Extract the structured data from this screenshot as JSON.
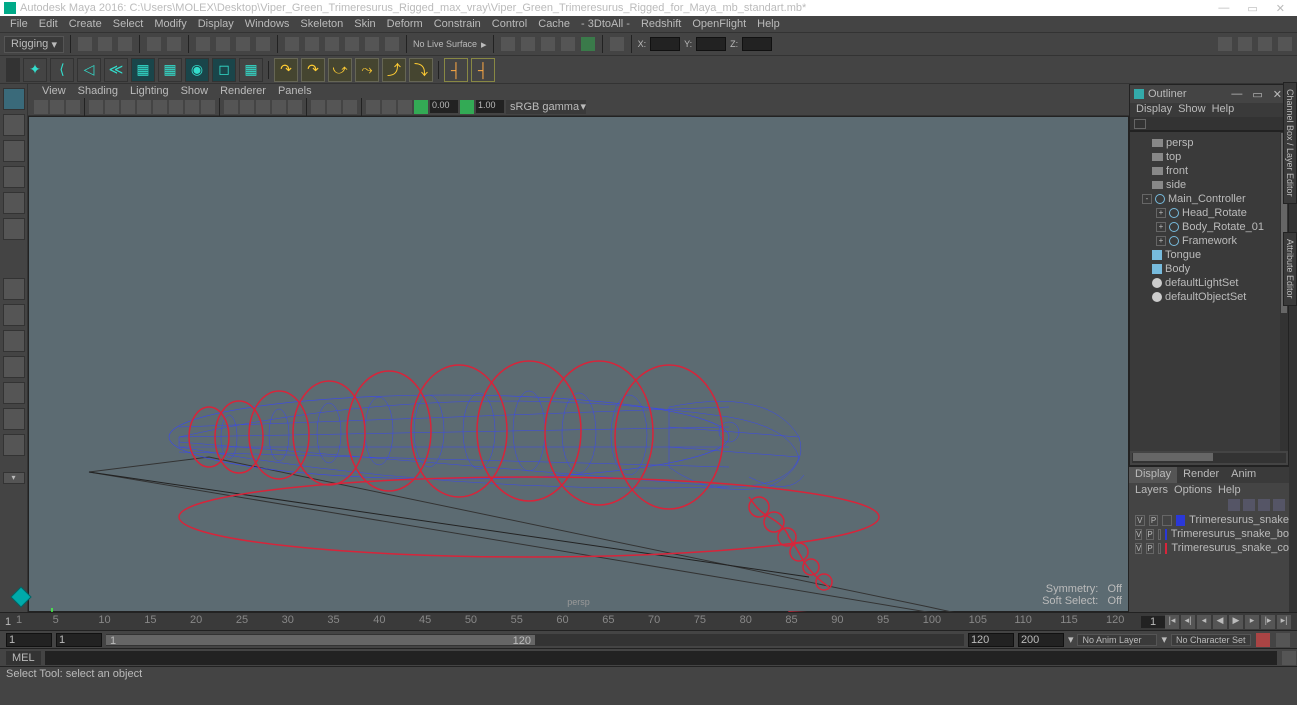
{
  "title": "Autodesk Maya 2016: C:\\Users\\MOLEX\\Desktop\\Viper_Green_Trimeresurus_Rigged_max_vray\\Viper_Green_Trimeresurus_Rigged_for_Maya_mb_standart.mb*",
  "menubar": [
    "File",
    "Edit",
    "Create",
    "Select",
    "Modify",
    "Display",
    "Windows",
    "Skeleton",
    "Skin",
    "Deform",
    "Constrain",
    "Control",
    "Cache",
    "- 3DtoAll -",
    "Redshift",
    "OpenFlight",
    "Help"
  ],
  "mode": "Rigging",
  "no_live": "No Live Surface",
  "coords": {
    "x": "X:",
    "y": "Y:",
    "z": "Z:"
  },
  "panel_menu": [
    "View",
    "Shading",
    "Lighting",
    "Show",
    "Renderer",
    "Panels"
  ],
  "gamma": "sRGB gamma",
  "field_a": "0.00",
  "field_b": "1.00",
  "vp_label": "persp",
  "vp_sym": "Symmetry:",
  "vp_sym_v": "Off",
  "vp_soft": "Soft Select:",
  "vp_soft_v": "Off",
  "outliner": {
    "title": "Outliner",
    "menu": [
      "Display",
      "Show",
      "Help"
    ],
    "items": [
      {
        "type": "cam",
        "label": "persp",
        "indent": 0
      },
      {
        "type": "cam",
        "label": "top",
        "indent": 0
      },
      {
        "type": "cam",
        "label": "front",
        "indent": 0
      },
      {
        "type": "cam",
        "label": "side",
        "indent": 0
      },
      {
        "type": "nurb",
        "label": "Main_Controller",
        "indent": 1,
        "exp": "-"
      },
      {
        "type": "nurb",
        "label": "Head_Rotate",
        "indent": 2,
        "exp": "+"
      },
      {
        "type": "nurb",
        "label": "Body_Rotate_01",
        "indent": 2,
        "exp": "+"
      },
      {
        "type": "nurb",
        "label": "Framework",
        "indent": 2,
        "exp": "+"
      },
      {
        "type": "mesh",
        "label": "Tongue",
        "indent": 0
      },
      {
        "type": "mesh",
        "label": "Body",
        "indent": 0
      },
      {
        "type": "set",
        "label": "defaultLightSet",
        "indent": 0
      },
      {
        "type": "set",
        "label": "defaultObjectSet",
        "indent": 0
      }
    ]
  },
  "layers": {
    "tabs": [
      "Display",
      "Render",
      "Anim"
    ],
    "menu": [
      "Layers",
      "Options",
      "Help"
    ],
    "rows": [
      {
        "v": "V",
        "p": "P",
        "color": "#2a38d8",
        "name": "Trimeresurus_snake"
      },
      {
        "v": "V",
        "p": "P",
        "color": "#2a38d8",
        "name": "Trimeresurus_snake_bo"
      },
      {
        "v": "V",
        "p": "P",
        "color": "#d8243a",
        "name": "Trimeresurus_snake_co"
      }
    ]
  },
  "timeline": {
    "ticks": [
      1,
      5,
      10,
      15,
      20,
      25,
      30,
      35,
      40,
      45,
      50,
      55,
      60,
      65,
      70,
      75,
      80,
      85,
      90,
      95,
      100,
      105,
      110,
      115,
      120
    ],
    "cur": "1"
  },
  "range": {
    "start": "1",
    "pstart": "1",
    "pend": "120",
    "end": "120",
    "fps": "200",
    "anim_layer": "No Anim Layer",
    "char_set": "No Character Set"
  },
  "cmd": {
    "lang": "MEL"
  },
  "help": "Select Tool: select an object",
  "side_tabs": [
    "Channel Box / Layer Editor",
    "Attribute Editor"
  ]
}
